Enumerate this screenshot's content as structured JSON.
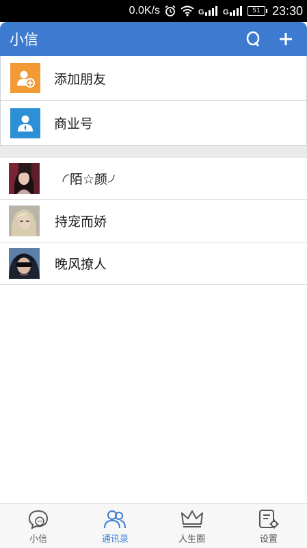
{
  "status_bar": {
    "speed": "0.0K/s",
    "battery": "51",
    "time": "23:30",
    "icons": [
      "alarm-icon",
      "wifi-icon",
      "signal-icon",
      "signal-icon",
      "battery-icon"
    ]
  },
  "app_bar": {
    "title": "小信",
    "color": "#3d7bd1",
    "actions": [
      "search-icon",
      "add-icon"
    ]
  },
  "top_items": [
    {
      "label": "添加朋友",
      "icon": "add-friend-icon",
      "color": "#f29a35"
    },
    {
      "label": "商业号",
      "icon": "business-account-icon",
      "color": "#2d8fd6"
    }
  ],
  "contacts": [
    {
      "name": "陌☆颜"
    },
    {
      "name": "持宠而娇"
    },
    {
      "name": "晚风撩人"
    }
  ],
  "tabs": [
    {
      "label": "小信",
      "icon": "chat-icon",
      "active": false
    },
    {
      "label": "通讯录",
      "icon": "contacts-icon",
      "active": true
    },
    {
      "label": "人生圈",
      "icon": "crown-icon",
      "active": false
    },
    {
      "label": "设置",
      "icon": "settings-icon",
      "active": false
    }
  ]
}
